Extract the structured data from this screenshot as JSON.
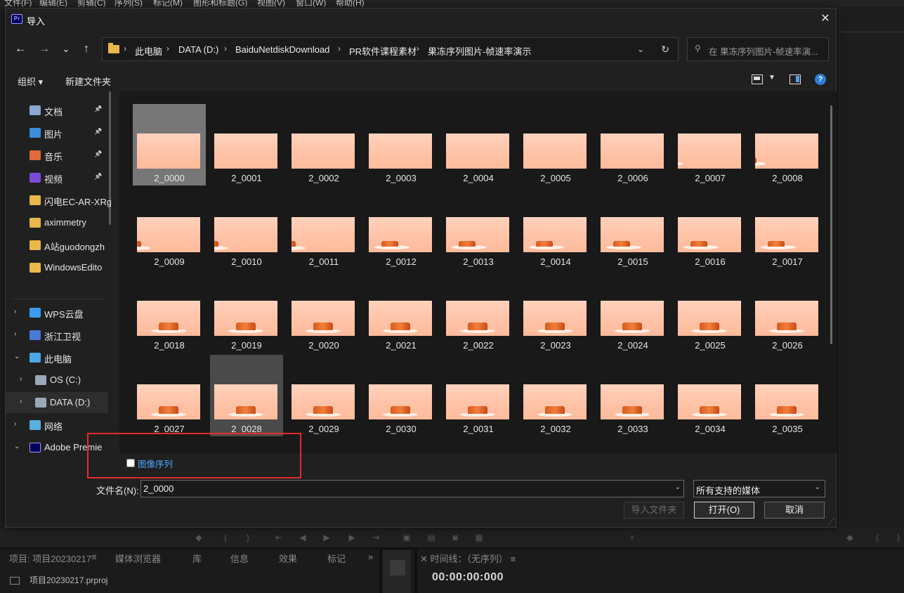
{
  "app": {
    "menus": [
      "文件(F)",
      "编辑(E)",
      "剪辑(C)",
      "序列(S)",
      "标记(M)",
      "图形和标题(G)",
      "视图(V)",
      "窗口(W)",
      "帮助(H)"
    ],
    "panel_tabs": [
      "项目: 项目20230217",
      "媒体浏览器",
      "库",
      "信息",
      "效果",
      "标记"
    ],
    "project_file": "项目20230217.prproj",
    "timeline_header": "时间线：（无序列）",
    "timecode": "00:00:00:000"
  },
  "dialog": {
    "logo": "Pr",
    "title": "导入",
    "close": "✕",
    "nav": {
      "back": "←",
      "forward": "→",
      "recent": "⌄",
      "up": "↑"
    },
    "breadcrumbs": [
      "此电脑",
      "DATA (D:)",
      "BaiduNetdiskDownload",
      "PR软件课程素材",
      "果冻序列图片-帧速率演示"
    ],
    "search_placeholder": "在 果冻序列图片-帧速率演...",
    "toolbar": {
      "organize": "组织 ▾",
      "new_folder": "新建文件夹",
      "help": "?"
    },
    "sidebar": {
      "quick": [
        {
          "label": "文档",
          "icon": "document-icon",
          "pinned": true
        },
        {
          "label": "图片",
          "icon": "pictures-icon",
          "pinned": true
        },
        {
          "label": "音乐",
          "icon": "music-icon",
          "pinned": true
        },
        {
          "label": "视频",
          "icon": "video-icon",
          "pinned": true
        },
        {
          "label": "闪电EC-AR-XRg",
          "icon": "folder-icon",
          "pinned": false
        },
        {
          "label": "aximmetry",
          "icon": "folder-icon",
          "pinned": false
        },
        {
          "label": "A站guodongzh",
          "icon": "folder-icon",
          "pinned": false
        },
        {
          "label": "WindowsEdito",
          "icon": "folder-icon",
          "pinned": false
        }
      ],
      "tree": [
        {
          "label": "WPS云盘",
          "arrow": "›",
          "icon": "cloud-icon"
        },
        {
          "label": "浙江卫视",
          "arrow": "›",
          "icon": "tv-icon"
        },
        {
          "label": "此电脑",
          "arrow": "⌄",
          "icon": "computer-icon"
        },
        {
          "label": "OS (C:)",
          "arrow": "›",
          "icon": "drive-icon"
        },
        {
          "label": "DATA (D:)",
          "arrow": "›",
          "icon": "drive-icon"
        },
        {
          "label": "网络",
          "arrow": "›",
          "icon": "network-icon"
        },
        {
          "label": "Adobe Premie",
          "arrow": "⌄",
          "icon": "premiere-icon"
        }
      ]
    },
    "files": [
      "2_0000",
      "2_0001",
      "2_0002",
      "2_0003",
      "2_0004",
      "2_0005",
      "2_0006",
      "2_0007",
      "2_0008",
      "2_0009",
      "2_0010",
      "2_0011",
      "2_0012",
      "2_0013",
      "2_0014",
      "2_0015",
      "2_0016",
      "2_0017",
      "2_0018",
      "2_0019",
      "2_0020",
      "2_0021",
      "2_0022",
      "2_0023",
      "2_0024",
      "2_0025",
      "2_0026",
      "2_0027",
      "2_0028",
      "2_0029",
      "2_0030",
      "2_0031",
      "2_0032",
      "2_0033",
      "2_0034",
      "2_0035"
    ],
    "image_sequence_label": "图像序列",
    "image_sequence_checked": false,
    "filename_label": "文件名(N):",
    "filename_value": "2_0000",
    "filetype_value": "所有支持的媒体",
    "buttons": {
      "import_folder": "导入文件夹",
      "open": "打开(O)",
      "cancel": "取消"
    }
  }
}
